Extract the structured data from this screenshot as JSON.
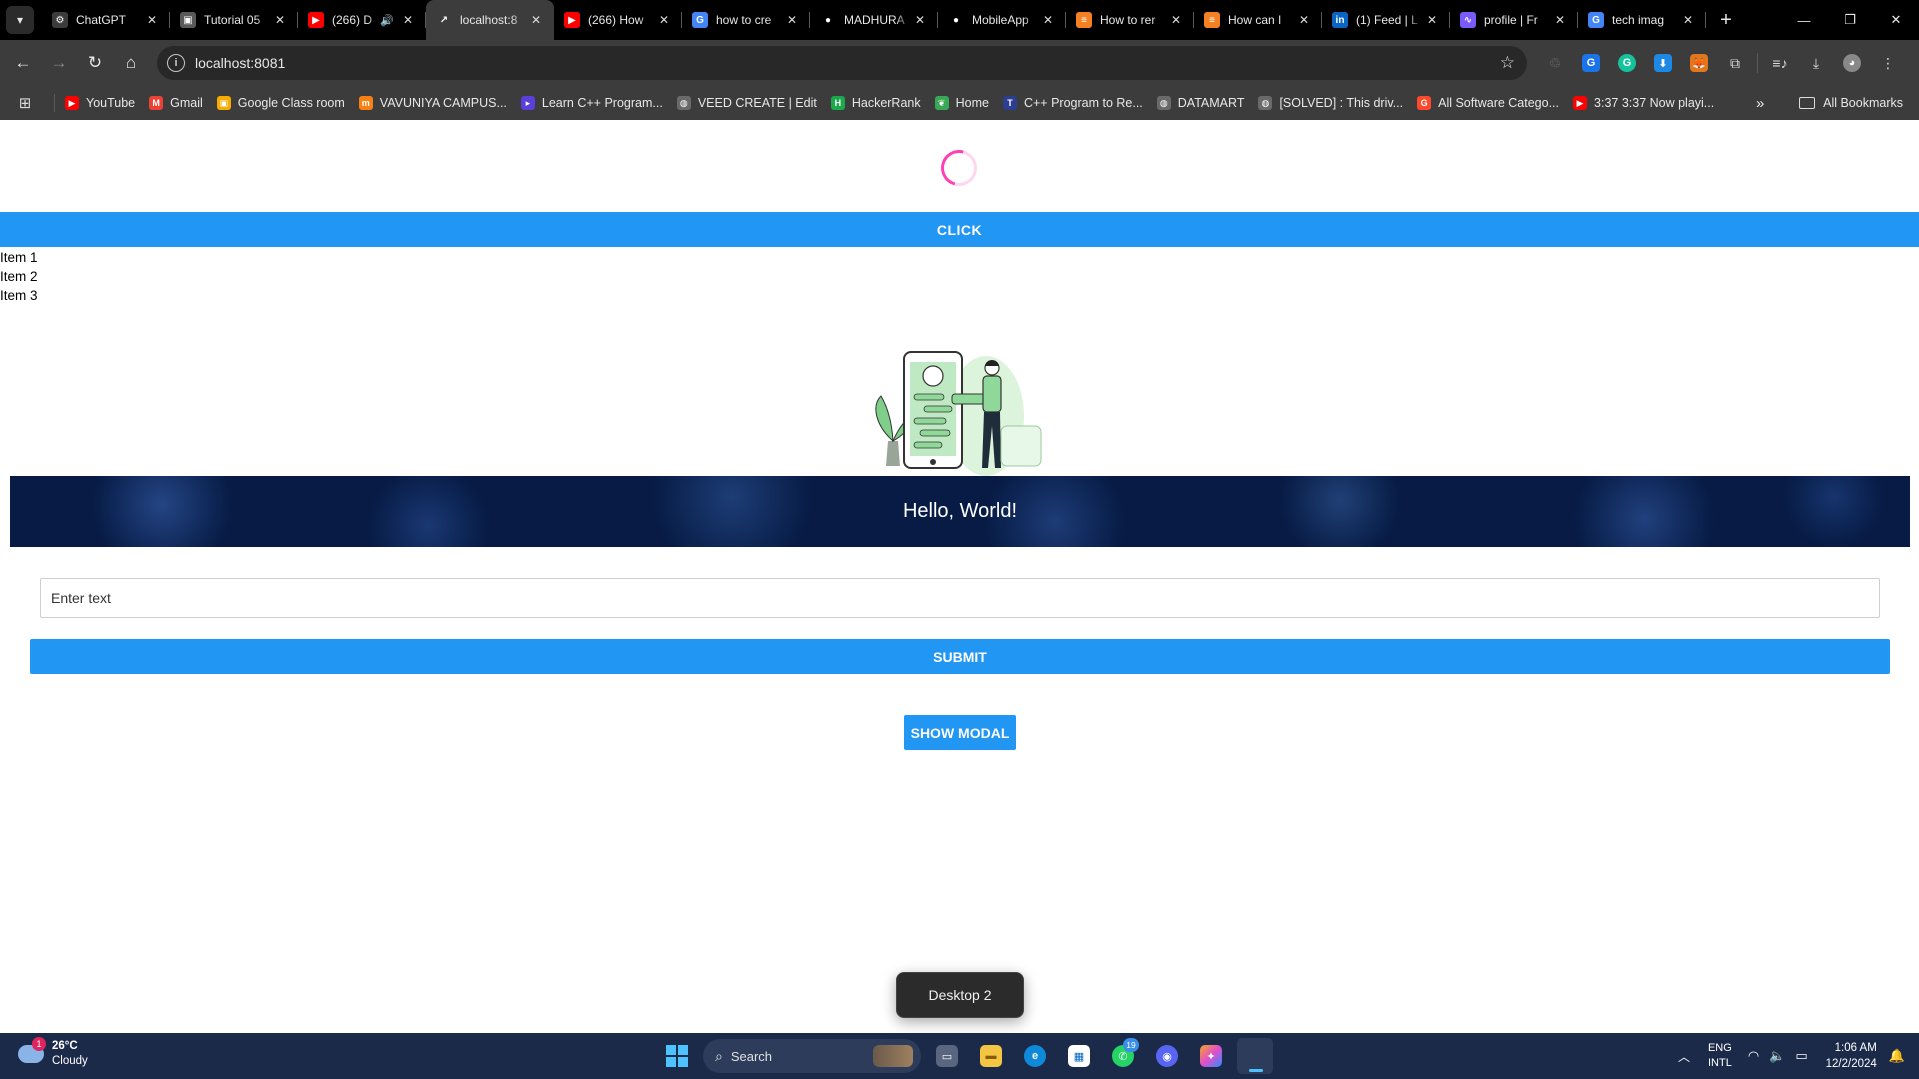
{
  "browser": {
    "tabs": [
      {
        "title": "ChatGPT",
        "icon": "chatgpt-icon",
        "color": "#3c3c3c",
        "glyph": "⚙"
      },
      {
        "title": "Tutorial 05",
        "icon": "classroom-icon",
        "color": "#5a5a5a",
        "glyph": "▣"
      },
      {
        "title": "(266) D",
        "icon": "youtube-icon",
        "color": "#ff0000",
        "glyph": "▶",
        "audio": "🔊"
      },
      {
        "title": "localhost:8",
        "icon": "expo-icon",
        "color": "#3c3c3c",
        "glyph": "↗",
        "active": true
      },
      {
        "title": "(266) How",
        "icon": "youtube-icon",
        "color": "#ff0000",
        "glyph": "▶"
      },
      {
        "title": "how to cre",
        "icon": "google-icon",
        "color": "#4285f4",
        "glyph": "G"
      },
      {
        "title": "MADHURA",
        "icon": "github-icon",
        "color": "#000000",
        "glyph": "●"
      },
      {
        "title": "MobileApp",
        "icon": "github-icon",
        "color": "#000000",
        "glyph": "●"
      },
      {
        "title": "How to rer",
        "icon": "stackoverflow-icon",
        "color": "#f48024",
        "glyph": "≡"
      },
      {
        "title": "How can I",
        "icon": "stackoverflow-icon",
        "color": "#f48024",
        "glyph": "≡"
      },
      {
        "title": "(1) Feed | L",
        "icon": "linkedin-icon",
        "color": "#0a66c2",
        "glyph": "in"
      },
      {
        "title": "profile | Fr",
        "icon": "framer-icon",
        "color": "#7a5af8",
        "glyph": "∿"
      },
      {
        "title": "tech imag",
        "icon": "google-icon",
        "color": "#4285f4",
        "glyph": "G"
      }
    ],
    "address": "localhost:8081",
    "bookmarks": [
      {
        "label": "YouTube",
        "icon": "youtube-icon",
        "color": "#ff0000",
        "glyph": "▶"
      },
      {
        "label": "Gmail",
        "icon": "gmail-icon",
        "color": "#ea4335",
        "glyph": "M"
      },
      {
        "label": "Google Class room",
        "icon": "classroom-icon",
        "color": "#f9ab00",
        "glyph": "▣"
      },
      {
        "label": "VAVUNIYA CAMPUS...",
        "icon": "moodle-icon",
        "color": "#f98012",
        "glyph": "m"
      },
      {
        "label": "Learn C++ Program...",
        "icon": "programiz-icon",
        "color": "#5b3fd8",
        "glyph": "▸"
      },
      {
        "label": "VEED CREATE | Edit",
        "icon": "globe-icon",
        "color": "#6a6a6a",
        "glyph": "◍"
      },
      {
        "label": "HackerRank",
        "icon": "hackerrank-icon",
        "color": "#1ba94c",
        "glyph": "H"
      },
      {
        "label": "Home",
        "icon": "leaf-icon",
        "color": "#3aa757",
        "glyph": "❦"
      },
      {
        "label": "C++ Program to Re...",
        "icon": "tutorialspoint-icon",
        "color": "#2c3e8f",
        "glyph": "T"
      },
      {
        "label": "DATAMART",
        "icon": "globe-icon",
        "color": "#6a6a6a",
        "glyph": "◍"
      },
      {
        "label": "[SOLVED] : This driv...",
        "icon": "globe-icon",
        "color": "#6a6a6a",
        "glyph": "◍"
      },
      {
        "label": "All Software Catego...",
        "icon": "g2-icon",
        "color": "#ff492c",
        "glyph": "G"
      },
      {
        "label": "3:37 3:37 Now playi...",
        "icon": "youtube-icon",
        "color": "#ff0000",
        "glyph": "▶"
      }
    ],
    "all_bookmarks_label": "All Bookmarks"
  },
  "page": {
    "click_label": "CLICK",
    "items": [
      "Item 1",
      "Item 2",
      "Item 3"
    ],
    "banner_text": "Hello, World!",
    "input_placeholder": "Enter text",
    "input_value": "",
    "submit_label": "SUBMIT",
    "show_modal_label": "SHOW MODAL",
    "accent_color": "#2196f3",
    "spinner_color": "#ff3fb2"
  },
  "desktop_toast": "Desktop 2",
  "taskbar": {
    "weather_temp": "26°C",
    "weather_desc": "Cloudy",
    "weather_badge": "1",
    "search_label": "Search",
    "whatsapp_badge": "19",
    "lang_line1": "ENG",
    "lang_line2": "INTL",
    "time": "1:06 AM",
    "date": "12/2/2024"
  }
}
